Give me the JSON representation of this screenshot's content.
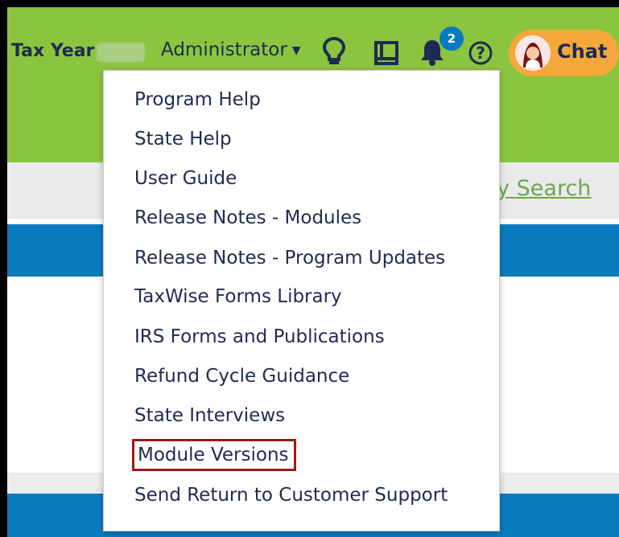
{
  "header": {
    "tax_year_label": "Tax Year",
    "role": "Administrator",
    "notification_count": "2",
    "chat_label": "Chat"
  },
  "background": {
    "search_link": "ry Search"
  },
  "help_menu": {
    "items": [
      "Program Help",
      "State Help",
      "User Guide",
      "Release Notes - Modules",
      "Release Notes - Program Updates",
      "TaxWise Forms Library",
      "IRS Forms and Publications",
      "Refund Cycle Guidance",
      "State Interviews",
      "Module Versions",
      "Send Return to Customer Support"
    ],
    "highlighted_item": "Module Versions"
  },
  "colors": {
    "header_green": "#8bc53f",
    "nav_blue": "#0b7bc0",
    "text_navy": "#1e2b52",
    "chat_orange": "#f6a73a",
    "highlight_red": "#a01818"
  },
  "icons": [
    "lightbulb-icon",
    "book-icon",
    "bell-icon",
    "help-icon",
    "agent-avatar-icon",
    "chevron-down-icon"
  ]
}
